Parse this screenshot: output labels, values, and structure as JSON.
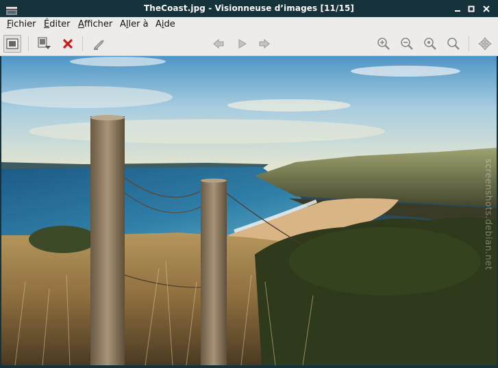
{
  "window": {
    "title": "TheCoast.jpg - Visionneuse d’images [11/15]"
  },
  "menubar": {
    "items": [
      {
        "label": "Fichier",
        "mnemonic": "F",
        "rest": "ichier"
      },
      {
        "label": "Éditer",
        "mnemonic": "É",
        "rest": "diter"
      },
      {
        "label": "Afficher",
        "mnemonic": "A",
        "rest": "fficher"
      },
      {
        "label": "Aller à",
        "pre": "A",
        "mnemonic": "l",
        "rest": "ler à"
      },
      {
        "label": "Aide",
        "pre": "A",
        "mnemonic": "i",
        "rest": "de"
      }
    ]
  },
  "toolbar": {
    "icons": [
      "fullscreen-icon",
      "save-icon",
      "delete-icon",
      "edit-icon",
      "back-icon",
      "play-icon",
      "forward-icon",
      "zoom-in-icon",
      "zoom-out-icon",
      "zoom-100-icon",
      "zoom-fit-icon",
      "move-icon"
    ]
  },
  "image": {
    "watermark": "screenshots.debian.net"
  },
  "colors": {
    "titlebar": "#16323a",
    "menubar": "#eeeceb",
    "delete_red": "#cc1a1a"
  }
}
